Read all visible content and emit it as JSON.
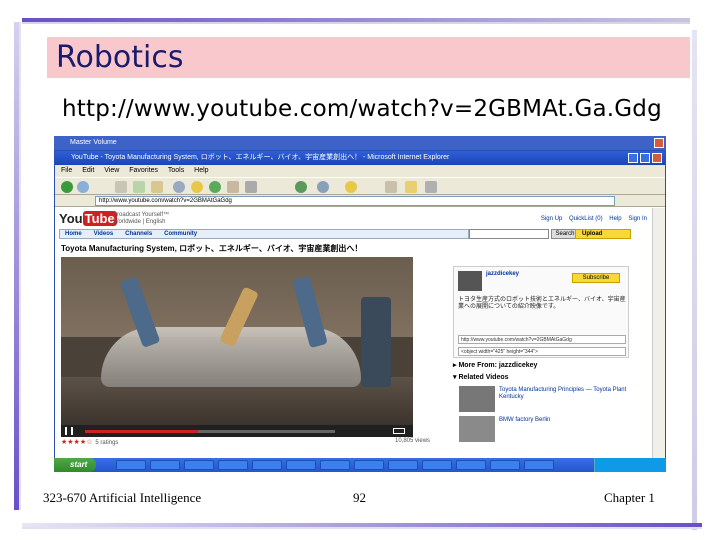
{
  "slide": {
    "title": "Robotics",
    "url": "http://www.youtube.com/watch?v=2GBMAt.Ga.Gdg",
    "footer_left": "323-670 Artificial Intelligence",
    "footer_page": "92",
    "footer_right": "Chapter 1"
  },
  "screenshot": {
    "outer_window_title": "Master Volume",
    "ie_title": "YouTube - Toyota Manufacturing System, ロボット、エネルギー、バイオ、宇宙産業創出へ！ - Microsoft Internet Explorer",
    "menu": [
      "File",
      "Edit",
      "View",
      "Favorites",
      "Tools",
      "Help"
    ],
    "address": "http://www.youtube.com/watch?v=2GBMAtGaGdg",
    "youtube": {
      "logo_you": "You",
      "logo_tube": "Tube",
      "tagline_1": "Broadcast Yourself™",
      "tagline_2": "Worldwide | English",
      "links": [
        "Sign Up",
        "QuickList (0)",
        "Help",
        "Sign In"
      ],
      "nav": [
        "Home",
        "Videos",
        "Channels",
        "Community"
      ],
      "search_button": "Search",
      "upload_button": "Upload",
      "video_title": "Toyota Manufacturing System, ロボット、エネルギー、バイオ、宇宙産業創出へ！",
      "rating_stars": "★★★★☆",
      "rating_count": "5 ratings",
      "views": "10,805 views",
      "channel_name": "jazzdicekey",
      "subscribe": "Subscribe",
      "description": "トヨタ生産方式のロボット技術とエネルギー、バイオ、宇宙産業への展開についての紹介映像です。",
      "url_field": "http://www.youtube.com/watch?v=2GBMAtGaGdg",
      "embed_field": "<object width=\"425\" height=\"344\">",
      "more_from": "More From: jazzdicekey",
      "related": "Related Videos",
      "related_items": [
        {
          "title": "Toyota Manufacturing Principles — Toyota Plant Kentucky"
        },
        {
          "title": "BMW factory Berlin"
        }
      ]
    },
    "taskbar": {
      "start": "start"
    }
  }
}
